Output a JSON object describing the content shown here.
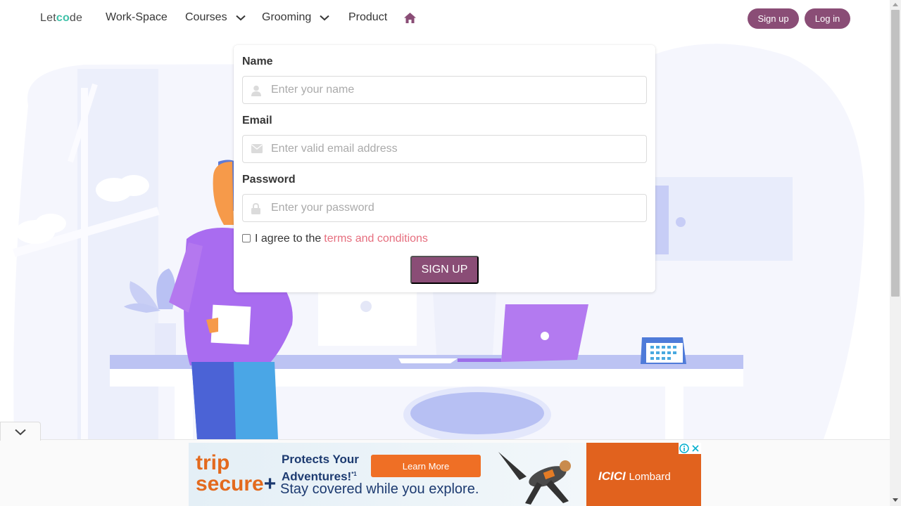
{
  "navbar": {
    "logo_pre": "Let",
    "logo_o": "co",
    "logo_post": "de",
    "items": [
      {
        "label": "Work-Space"
      },
      {
        "label": "Courses"
      },
      {
        "label": "Grooming"
      },
      {
        "label": "Product"
      }
    ],
    "signup_label": "Sign up",
    "login_label": "Log in"
  },
  "form": {
    "name_label": "Name",
    "name_placeholder": "Enter your name",
    "email_label": "Email",
    "email_placeholder": "Enter valid email address",
    "password_label": "Password",
    "password_placeholder": "Enter your password",
    "agree_text": "I agree to the",
    "terms_link": "terms and conditions",
    "submit_label": "SIGN UP"
  },
  "ad": {
    "brand_top": "trip",
    "brand_bottom": "secure",
    "brand_plus": "+",
    "headline_1": "Protects Your",
    "headline_2": "Adventures!",
    "headline_sup": "*1",
    "subline": "Stay covered while you explore.",
    "cta": "Learn More",
    "sponsor": "ICICI",
    "sponsor_2": "Lombard"
  },
  "colors": {
    "brand": "#8a4d76",
    "terms_link": "#e66e7e",
    "illustration_light": "#eef1fc",
    "ad_orange": "#ef6f25"
  },
  "icons": {
    "home": "home-icon",
    "name_field": "user-icon",
    "email_field": "envelope-icon",
    "password_field": "lock-icon"
  }
}
